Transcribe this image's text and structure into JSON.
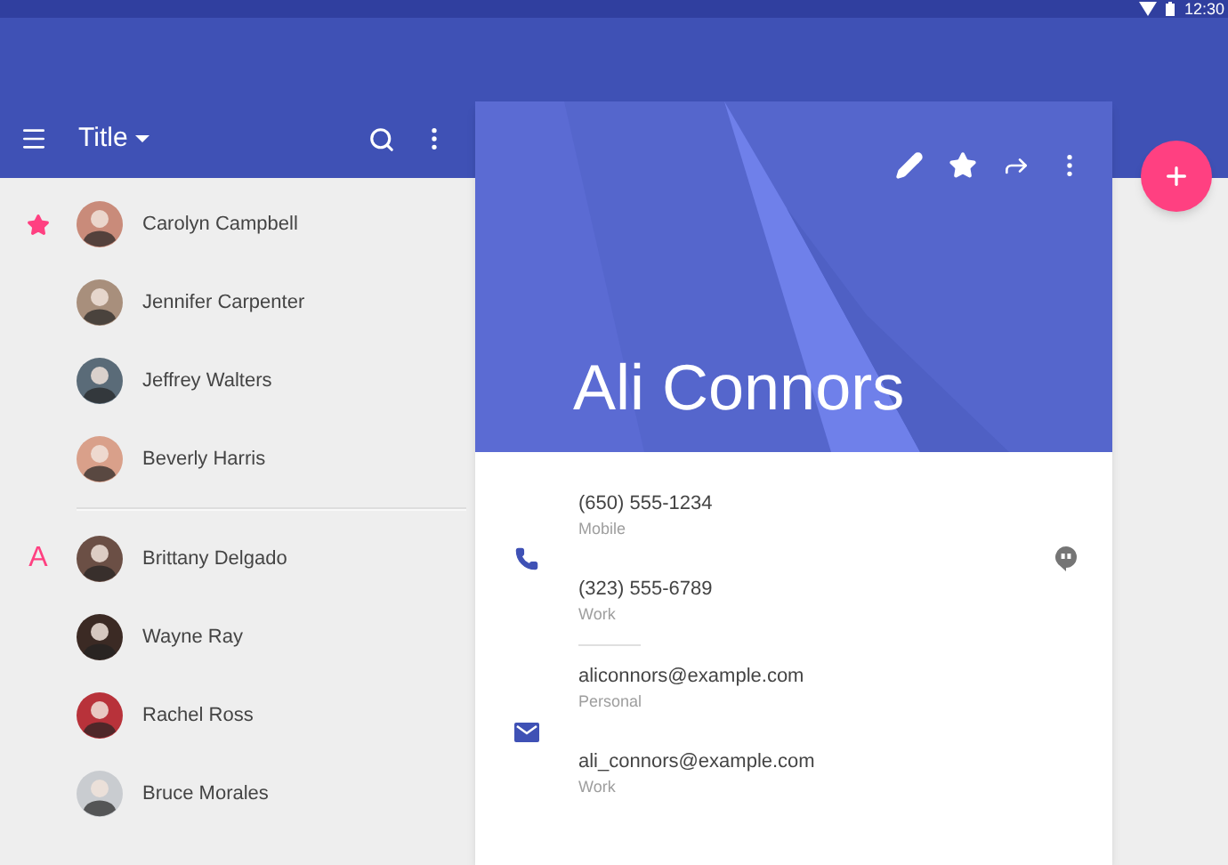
{
  "status_bar": {
    "time": "12:30"
  },
  "toolbar": {
    "title": "Title"
  },
  "contact_sections": [
    {
      "kind": "starred",
      "contacts": [
        {
          "name": "Carolyn Campbell"
        },
        {
          "name": "Jennifer Carpenter"
        },
        {
          "name": "Jeffrey Walters"
        },
        {
          "name": "Beverly Harris"
        }
      ]
    },
    {
      "kind": "letter",
      "letter": "A",
      "contacts": [
        {
          "name": "Brittany Delgado"
        },
        {
          "name": "Wayne Ray"
        },
        {
          "name": "Rachel Ross"
        },
        {
          "name": "Bruce Morales"
        }
      ]
    }
  ],
  "card": {
    "name": "Ali Connors",
    "sections": [
      {
        "kind": "phone",
        "entries": [
          {
            "value": "(650) 555-1234",
            "label": "Mobile"
          },
          {
            "value": "(323) 555-6789",
            "label": "Work"
          }
        ]
      },
      {
        "kind": "email",
        "entries": [
          {
            "value": "aliconnors@example.com",
            "label": "Personal"
          },
          {
            "value": "ali_connors@example.com",
            "label": "Work"
          }
        ]
      }
    ]
  }
}
